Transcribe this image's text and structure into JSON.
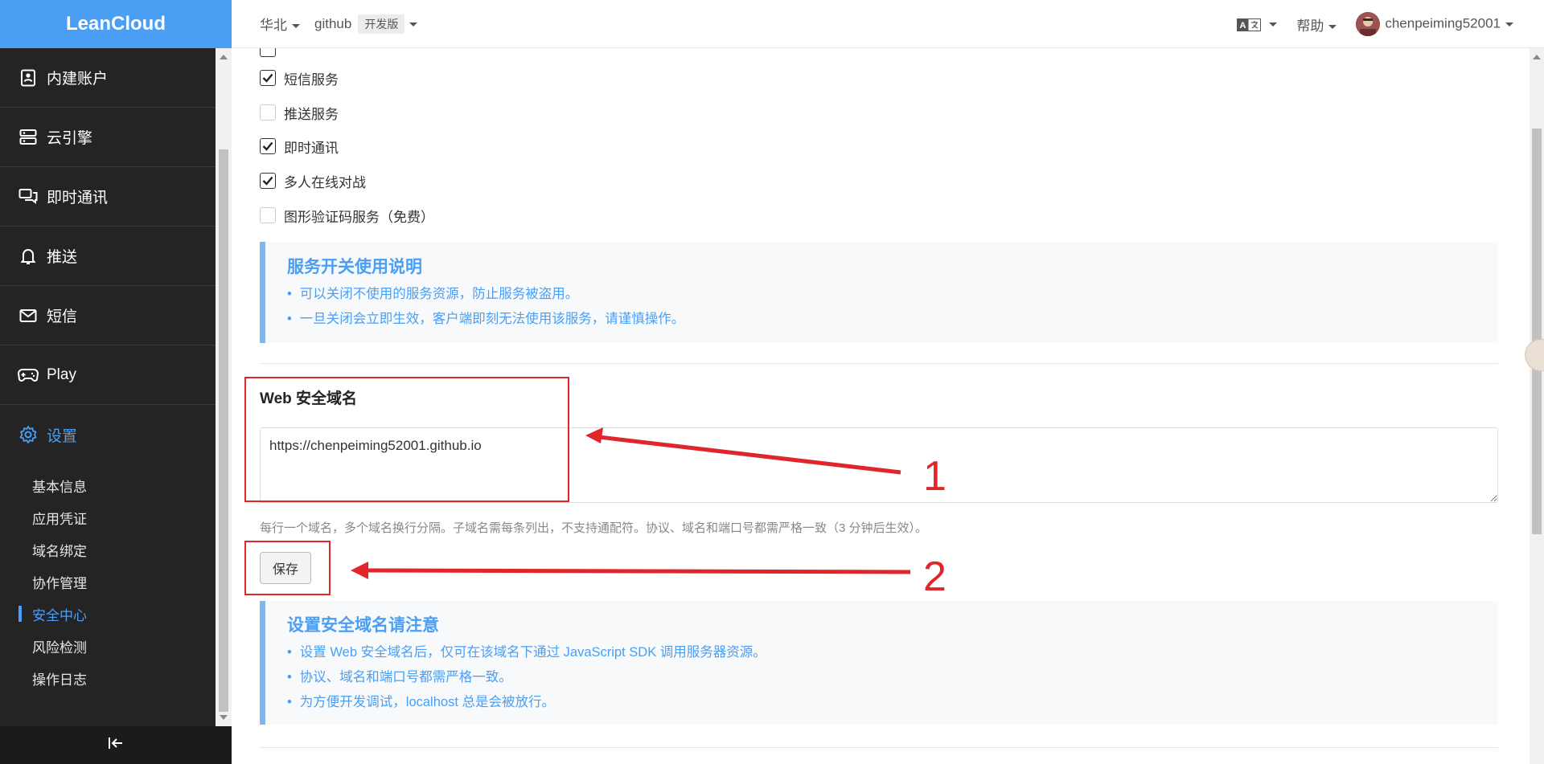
{
  "sidebar": {
    "brand": "LeanCloud",
    "items": [
      {
        "label": "内建账户",
        "icon": "id-card-icon"
      },
      {
        "label": "云引擎",
        "icon": "server-icon"
      },
      {
        "label": "即时通讯",
        "icon": "chat-icon"
      },
      {
        "label": "推送",
        "icon": "bell-icon"
      },
      {
        "label": "短信",
        "icon": "envelope-icon"
      },
      {
        "label": "Play",
        "icon": "gamepad-icon"
      },
      {
        "label": "设置",
        "icon": "gear-icon",
        "active": true
      }
    ],
    "sub_items": [
      "基本信息",
      "应用凭证",
      "域名绑定",
      "协作管理",
      "安全中心",
      "风险检测",
      "操作日志"
    ],
    "active_sub_item": "安全中心",
    "collapse_icon": "collapse-left-icon"
  },
  "topbar": {
    "region": "华北",
    "app": "github",
    "plan_badge": "开发版",
    "language_icon": "translate-icon",
    "help": "帮助",
    "username": "chenpeiming52001"
  },
  "services": [
    {
      "label": "短信服务",
      "checked": true
    },
    {
      "label": "推送服务",
      "checked": false
    },
    {
      "label": "即时通讯",
      "checked": true
    },
    {
      "label": "多人在线对战",
      "checked": true
    },
    {
      "label": "图形验证码服务（免费）",
      "checked": false
    }
  ],
  "service_note": {
    "title": "服务开关使用说明",
    "items": [
      "可以关闭不使用的服务资源，防止服务被盗用。",
      "一旦关闭会立即生效，客户端即刻无法使用该服务，请谨慎操作。"
    ]
  },
  "web_domain": {
    "label": "Web 安全域名",
    "value": "https://chenpeiming52001.github.io",
    "help": "每行一个域名，多个域名换行分隔。子域名需每条列出，不支持通配符。协议、域名和端口号都需严格一致（3 分钟后生效）。",
    "save_label": "保存"
  },
  "domain_note": {
    "title": "设置安全域名请注意",
    "items": [
      "设置 Web 安全域名后，仅可在该域名下通过 JavaScript SDK 调用服务器资源。",
      "协议、域名和端口号都需严格一致。",
      "为方便开发调试，localhost 总是会被放行。"
    ]
  },
  "annotations": {
    "marker_1": "1",
    "marker_2": "2",
    "color": "#e0262b"
  }
}
